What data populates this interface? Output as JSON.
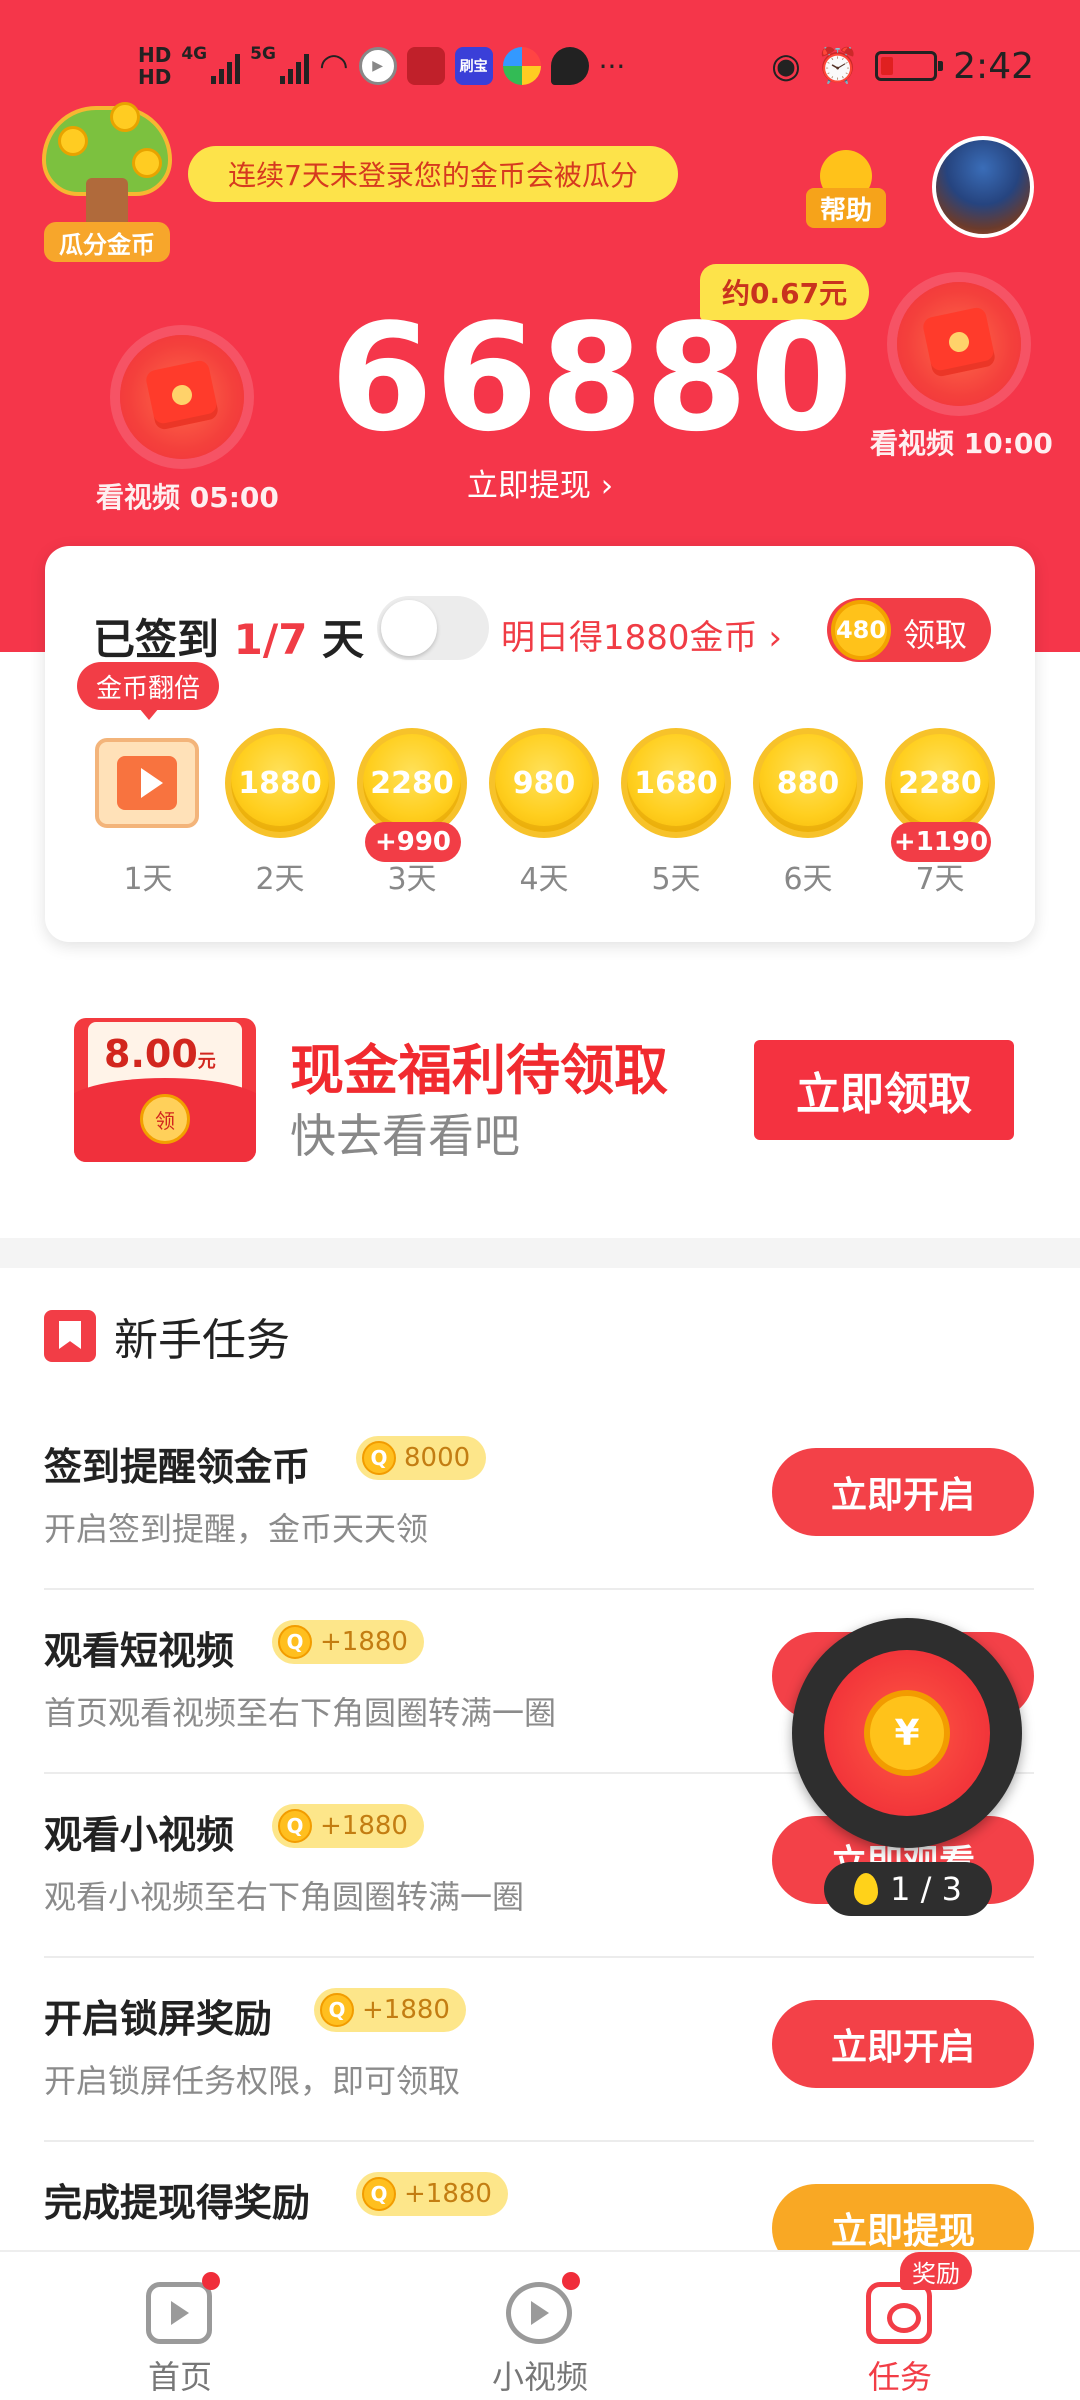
{
  "statusbar": {
    "time": "2:42",
    "hd1": "HD",
    "hd2": "HD",
    "net1": "4G",
    "net2": "5G",
    "app_badge_1": "",
    "app_badge_2": "刷宝",
    "more": "···"
  },
  "header": {
    "tree_label": "瓜分金币",
    "notice": "连续7天未登录您的金币会被瓜分",
    "help_label": "帮助",
    "coins": "66880",
    "approx_value": "约0.67元",
    "withdraw_label": "立即提现 ›",
    "video_left_label": "看视频 05:00",
    "video_right_label": "看视频 10:00"
  },
  "checkin": {
    "prefix": "已签到 ",
    "progress": "1/7",
    "suffix": " 天",
    "tomorrow": "明日得1880金币 ›",
    "claim_coin": "480",
    "claim_label": "领取",
    "double_tag": "金币翻倍",
    "days": [
      {
        "label": "1天",
        "value": "",
        "bonus": ""
      },
      {
        "label": "2天",
        "value": "1880",
        "bonus": ""
      },
      {
        "label": "3天",
        "value": "2280",
        "bonus": "+990"
      },
      {
        "label": "4天",
        "value": "980",
        "bonus": ""
      },
      {
        "label": "5天",
        "value": "1680",
        "bonus": ""
      },
      {
        "label": "6天",
        "value": "880",
        "bonus": ""
      },
      {
        "label": "7天",
        "value": "2280",
        "bonus": "+1190"
      }
    ]
  },
  "cash": {
    "amount": "8.00",
    "unit": "元",
    "seal": "领",
    "title": "现金福利待领取",
    "subtitle": "快去看看吧",
    "button": "立即领取"
  },
  "tasks": {
    "heading": "新手任务",
    "items": [
      {
        "name": "签到提醒领金币",
        "reward": "8000",
        "desc": "开启签到提醒，金币天天领",
        "button": "立即开启"
      },
      {
        "name": "观看短视频",
        "reward": "+1880",
        "desc": "首页观看视频至右下角圆圈转满一圈",
        "button": "立即观看"
      },
      {
        "name": "观看小视频",
        "reward": "+1880",
        "desc": "观看小视频至右下角圆圈转满一圈",
        "button": "立即观看"
      },
      {
        "name": "开启锁屏奖励",
        "reward": "+1880",
        "desc": "开启锁屏任务权限，即可领取",
        "button": "立即开启"
      },
      {
        "name": "完成提现得奖励",
        "reward": "+1880",
        "desc": "",
        "button": "立即提现"
      }
    ]
  },
  "floating": {
    "coin_symbol": "¥",
    "progress": "1 / 3"
  },
  "nav": {
    "items": [
      {
        "label": "首页"
      },
      {
        "label": "小视频"
      },
      {
        "label": "任务"
      }
    ],
    "badge": "奖励"
  },
  "colors": {
    "brand_red": "#f5364a",
    "accent_yellow": "#fde34a",
    "coin_gold": "#ffcf1f"
  }
}
